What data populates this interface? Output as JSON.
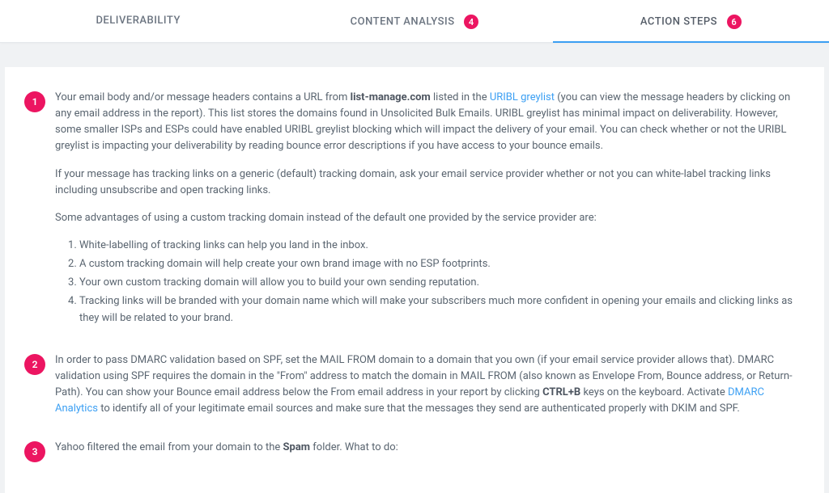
{
  "tabs": {
    "deliverability": {
      "label": "DELIVERABILITY"
    },
    "content_analysis": {
      "label": "CONTENT ANALYSIS",
      "badge": "4"
    },
    "action_steps": {
      "label": "ACTION STEPS",
      "badge": "6"
    }
  },
  "steps": [
    {
      "num": "1",
      "p1_a": "Your email body and/or message headers contains a URL from ",
      "p1_bold": "list-manage.com",
      "p1_b": " listed in the ",
      "p1_link": "URIBL greylist",
      "p1_c": " (you can view the message headers by clicking on any email address in the report). This list stores the domains found in Unsolicited Bulk Emails. URIBL greylist has minimal impact on deliverability. However, some smaller ISPs and ESPs could have enabled URIBL greylist blocking which will impact the delivery of your email. You can check whether or not the URIBL greylist is impacting your deliverability by reading bounce error descriptions if you have access to your bounce emails.",
      "p2": "If your message has tracking links on a generic (default) tracking domain, ask your email service provider whether or not you can white-label tracking links including unsubscribe and open tracking links.",
      "p3": "Some advantages of using a custom tracking domain instead of the default one provided by the service provider are:",
      "ol": [
        "White-labelling of tracking links can help you land in the inbox.",
        "A custom tracking domain will help create your own brand image with no ESP footprints.",
        "Your own custom tracking domain will allow you to build your own sending reputation.",
        "Tracking links will be branded with your domain name which will make your subscribers much more confident in opening your emails and clicking links as they will be related to your brand."
      ]
    },
    {
      "num": "2",
      "p1_a": "In order to pass DMARC validation based on SPF, set the MAIL FROM domain to a domain that you own (if your email service provider allows that). DMARC validation using SPF requires the domain in the \"From\" address to match the domain in MAIL FROM (also known as Envelope From, Bounce address, or Return-Path). You can show your Bounce email address below the From email address in your report by clicking ",
      "p1_bold": "CTRL+B",
      "p1_b": " keys on the keyboard. Activate ",
      "p1_link": "DMARC Analytics",
      "p1_c": " to identify all of your legitimate email sources and make sure that the messages they send are authenticated properly with DKIM and SPF."
    },
    {
      "num": "3",
      "p1_a": "Yahoo filtered the email from your domain to the ",
      "p1_bold": "Spam",
      "p1_b": " folder. What to do:"
    }
  ]
}
